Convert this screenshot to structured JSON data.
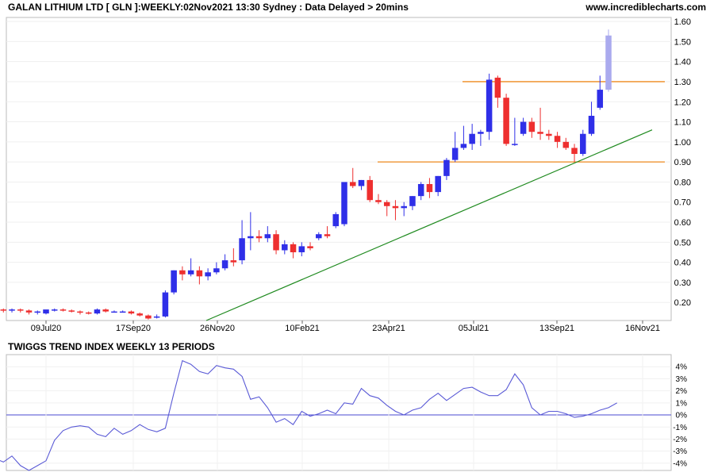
{
  "header": {
    "title": "GALAN LITHIUM LTD [ GLN ]:WEEKLY:02Nov2021 13:30 Sydney : Data Delayed > 20mins",
    "site": "www.incrediblecharts.com"
  },
  "chart_data": [
    {
      "type": "candlestick",
      "title": "GALAN LITHIUM LTD [ GLN ]:WEEKLY:02Nov2021 13:30 Sydney : Data Delayed > 20mins",
      "ylim": [
        0.11,
        1.62
      ],
      "yticks": [
        "0.20",
        "0.30",
        "0.40",
        "0.50",
        "0.60",
        "0.70",
        "0.80",
        "0.90",
        "1.00",
        "1.10",
        "1.20",
        "1.30",
        "1.40",
        "1.50",
        "1.60"
      ],
      "xticks": [
        "09Jul20",
        "17Sep20",
        "26Nov20",
        "10Feb21",
        "23Apr21",
        "05Jul21",
        "13Sep21",
        "16Nov21"
      ],
      "colors": {
        "up": "#2f2fe8",
        "down": "#ee2f2f",
        "current": "#aaaaee",
        "support": "#ee8a1e",
        "trend": "#1f8a1f",
        "indicator": "#5a5ad6",
        "zeroline": "#4a4ad0"
      },
      "candles": [
        {
          "o": 0.17,
          "h": 0.2,
          "l": 0.16,
          "c": 0.19
        },
        {
          "o": 0.19,
          "h": 0.2,
          "l": 0.16,
          "c": 0.17
        },
        {
          "o": 0.17,
          "h": 0.18,
          "l": 0.16,
          "c": 0.165
        },
        {
          "o": 0.165,
          "h": 0.17,
          "l": 0.15,
          "c": 0.16
        },
        {
          "o": 0.16,
          "h": 0.17,
          "l": 0.15,
          "c": 0.165
        },
        {
          "o": 0.165,
          "h": 0.17,
          "l": 0.15,
          "c": 0.16
        },
        {
          "o": 0.16,
          "h": 0.165,
          "l": 0.14,
          "c": 0.15
        },
        {
          "o": 0.15,
          "h": 0.16,
          "l": 0.14,
          "c": 0.155
        },
        {
          "o": 0.145,
          "h": 0.16,
          "l": 0.14,
          "c": 0.165
        },
        {
          "o": 0.16,
          "h": 0.17,
          "l": 0.155,
          "c": 0.165
        },
        {
          "o": 0.165,
          "h": 0.17,
          "l": 0.155,
          "c": 0.16
        },
        {
          "o": 0.16,
          "h": 0.165,
          "l": 0.15,
          "c": 0.155
        },
        {
          "o": 0.155,
          "h": 0.16,
          "l": 0.14,
          "c": 0.15
        },
        {
          "o": 0.15,
          "h": 0.155,
          "l": 0.14,
          "c": 0.145
        },
        {
          "o": 0.145,
          "h": 0.17,
          "l": 0.14,
          "c": 0.165
        },
        {
          "o": 0.165,
          "h": 0.17,
          "l": 0.15,
          "c": 0.155
        },
        {
          "o": 0.155,
          "h": 0.16,
          "l": 0.15,
          "c": 0.155
        },
        {
          "o": 0.155,
          "h": 0.16,
          "l": 0.15,
          "c": 0.155
        },
        {
          "o": 0.155,
          "h": 0.16,
          "l": 0.14,
          "c": 0.145
        },
        {
          "o": 0.145,
          "h": 0.15,
          "l": 0.13,
          "c": 0.135
        },
        {
          "o": 0.135,
          "h": 0.14,
          "l": 0.115,
          "c": 0.12
        },
        {
          "o": 0.125,
          "h": 0.14,
          "l": 0.12,
          "c": 0.13
        },
        {
          "o": 0.13,
          "h": 0.26,
          "l": 0.125,
          "c": 0.25
        },
        {
          "o": 0.25,
          "h": 0.36,
          "l": 0.24,
          "c": 0.36
        },
        {
          "o": 0.36,
          "h": 0.38,
          "l": 0.31,
          "c": 0.34
        },
        {
          "o": 0.34,
          "h": 0.42,
          "l": 0.33,
          "c": 0.36
        },
        {
          "o": 0.36,
          "h": 0.38,
          "l": 0.29,
          "c": 0.33
        },
        {
          "o": 0.33,
          "h": 0.37,
          "l": 0.31,
          "c": 0.35
        },
        {
          "o": 0.35,
          "h": 0.4,
          "l": 0.34,
          "c": 0.37
        },
        {
          "o": 0.37,
          "h": 0.44,
          "l": 0.36,
          "c": 0.41
        },
        {
          "o": 0.41,
          "h": 0.47,
          "l": 0.38,
          "c": 0.4
        },
        {
          "o": 0.41,
          "h": 0.61,
          "l": 0.39,
          "c": 0.52
        },
        {
          "o": 0.52,
          "h": 0.65,
          "l": 0.46,
          "c": 0.53
        },
        {
          "o": 0.53,
          "h": 0.56,
          "l": 0.5,
          "c": 0.52
        },
        {
          "o": 0.52,
          "h": 0.58,
          "l": 0.5,
          "c": 0.54
        },
        {
          "o": 0.54,
          "h": 0.56,
          "l": 0.44,
          "c": 0.46
        },
        {
          "o": 0.46,
          "h": 0.51,
          "l": 0.44,
          "c": 0.49
        },
        {
          "o": 0.49,
          "h": 0.5,
          "l": 0.42,
          "c": 0.45
        },
        {
          "o": 0.45,
          "h": 0.5,
          "l": 0.43,
          "c": 0.48
        },
        {
          "o": 0.48,
          "h": 0.5,
          "l": 0.46,
          "c": 0.47
        },
        {
          "o": 0.52,
          "h": 0.55,
          "l": 0.51,
          "c": 0.54
        },
        {
          "o": 0.54,
          "h": 0.58,
          "l": 0.52,
          "c": 0.53
        },
        {
          "o": 0.58,
          "h": 0.65,
          "l": 0.57,
          "c": 0.64
        },
        {
          "o": 0.59,
          "h": 0.8,
          "l": 0.58,
          "c": 0.8
        },
        {
          "o": 0.8,
          "h": 0.87,
          "l": 0.77,
          "c": 0.78
        },
        {
          "o": 0.78,
          "h": 0.81,
          "l": 0.76,
          "c": 0.81
        },
        {
          "o": 0.81,
          "h": 0.83,
          "l": 0.7,
          "c": 0.71
        },
        {
          "o": 0.71,
          "h": 0.74,
          "l": 0.69,
          "c": 0.7
        },
        {
          "o": 0.7,
          "h": 0.71,
          "l": 0.63,
          "c": 0.68
        },
        {
          "o": 0.68,
          "h": 0.71,
          "l": 0.61,
          "c": 0.67
        },
        {
          "o": 0.67,
          "h": 0.7,
          "l": 0.63,
          "c": 0.68
        },
        {
          "o": 0.68,
          "h": 0.73,
          "l": 0.66,
          "c": 0.73
        },
        {
          "o": 0.73,
          "h": 0.8,
          "l": 0.71,
          "c": 0.79
        },
        {
          "o": 0.79,
          "h": 0.82,
          "l": 0.72,
          "c": 0.75
        },
        {
          "o": 0.75,
          "h": 0.83,
          "l": 0.73,
          "c": 0.83
        },
        {
          "o": 0.83,
          "h": 0.92,
          "l": 0.81,
          "c": 0.91
        },
        {
          "o": 0.91,
          "h": 1.05,
          "l": 0.9,
          "c": 0.97
        },
        {
          "o": 0.97,
          "h": 1.08,
          "l": 0.96,
          "c": 0.99
        },
        {
          "o": 0.99,
          "h": 1.09,
          "l": 0.96,
          "c": 1.04
        },
        {
          "o": 1.04,
          "h": 1.06,
          "l": 0.98,
          "c": 1.05
        },
        {
          "o": 1.05,
          "h": 1.34,
          "l": 1.01,
          "c": 1.31
        },
        {
          "o": 1.32,
          "h": 1.33,
          "l": 1.17,
          "c": 1.22
        },
        {
          "o": 1.22,
          "h": 1.24,
          "l": 0.98,
          "c": 0.99
        },
        {
          "o": 0.99,
          "h": 1.12,
          "l": 0.98,
          "c": 0.99
        },
        {
          "o": 1.04,
          "h": 1.12,
          "l": 1.03,
          "c": 1.1
        },
        {
          "o": 1.1,
          "h": 1.12,
          "l": 1.02,
          "c": 1.05
        },
        {
          "o": 1.05,
          "h": 1.17,
          "l": 1.01,
          "c": 1.04
        },
        {
          "o": 1.04,
          "h": 1.06,
          "l": 1.01,
          "c": 1.03
        },
        {
          "o": 1.03,
          "h": 1.05,
          "l": 0.97,
          "c": 1.0
        },
        {
          "o": 1.0,
          "h": 1.02,
          "l": 0.96,
          "c": 0.97
        },
        {
          "o": 0.97,
          "h": 0.99,
          "l": 0.9,
          "c": 0.94
        },
        {
          "o": 0.94,
          "h": 1.06,
          "l": 0.93,
          "c": 1.04
        },
        {
          "o": 1.04,
          "h": 1.2,
          "l": 1.03,
          "c": 1.13
        },
        {
          "o": 1.17,
          "h": 1.33,
          "l": 1.16,
          "c": 1.26
        },
        {
          "o": 1.26,
          "h": 1.56,
          "l": 1.25,
          "c": 1.53
        }
      ],
      "support_lines": [
        {
          "y": 0.9,
          "x_from": "23Apr21",
          "x_to": "16Nov21"
        },
        {
          "y": 1.3,
          "x_from": "05Jul21",
          "x_to": "16Nov21"
        }
      ],
      "trend_line": {
        "from": {
          "x": "26Nov20",
          "y": 0.11
        },
        "to": {
          "x": "16Nov21",
          "y": 1.06
        }
      }
    },
    {
      "type": "line",
      "title": "TWIGGS TREND INDEX WEEKLY 13 PERIODS",
      "ylim": [
        -4.6,
        5.0
      ],
      "yticks": [
        "4%",
        "3%",
        "2%",
        "1%",
        "0%",
        "-1%",
        "-2%",
        "-3%",
        "-4%"
      ],
      "y": [
        -2.8,
        -3.7,
        -3.6,
        -3.9,
        -3.4,
        -4.2,
        -4.6,
        -4.2,
        -3.8,
        -2.1,
        -1.3,
        -1.0,
        -0.9,
        -1.0,
        -1.6,
        -1.8,
        -1.1,
        -1.6,
        -1.3,
        -0.8,
        -1.2,
        -1.4,
        -1.1,
        1.8,
        4.5,
        4.2,
        3.6,
        3.4,
        4.1,
        3.9,
        3.8,
        3.2,
        1.3,
        1.5,
        0.6,
        -0.6,
        -0.3,
        -0.8,
        0.3,
        -0.1,
        0.1,
        0.4,
        0.1,
        1.0,
        0.9,
        2.2,
        1.6,
        1.4,
        0.8,
        0.3,
        0.0,
        0.4,
        0.6,
        1.3,
        1.8,
        1.2,
        1.7,
        2.2,
        2.3,
        1.9,
        1.6,
        1.6,
        2.1,
        3.4,
        2.5,
        0.6,
        0.0,
        0.3,
        0.3,
        0.1,
        -0.2,
        -0.1,
        0.1,
        0.4,
        0.6,
        1.0
      ]
    }
  ]
}
